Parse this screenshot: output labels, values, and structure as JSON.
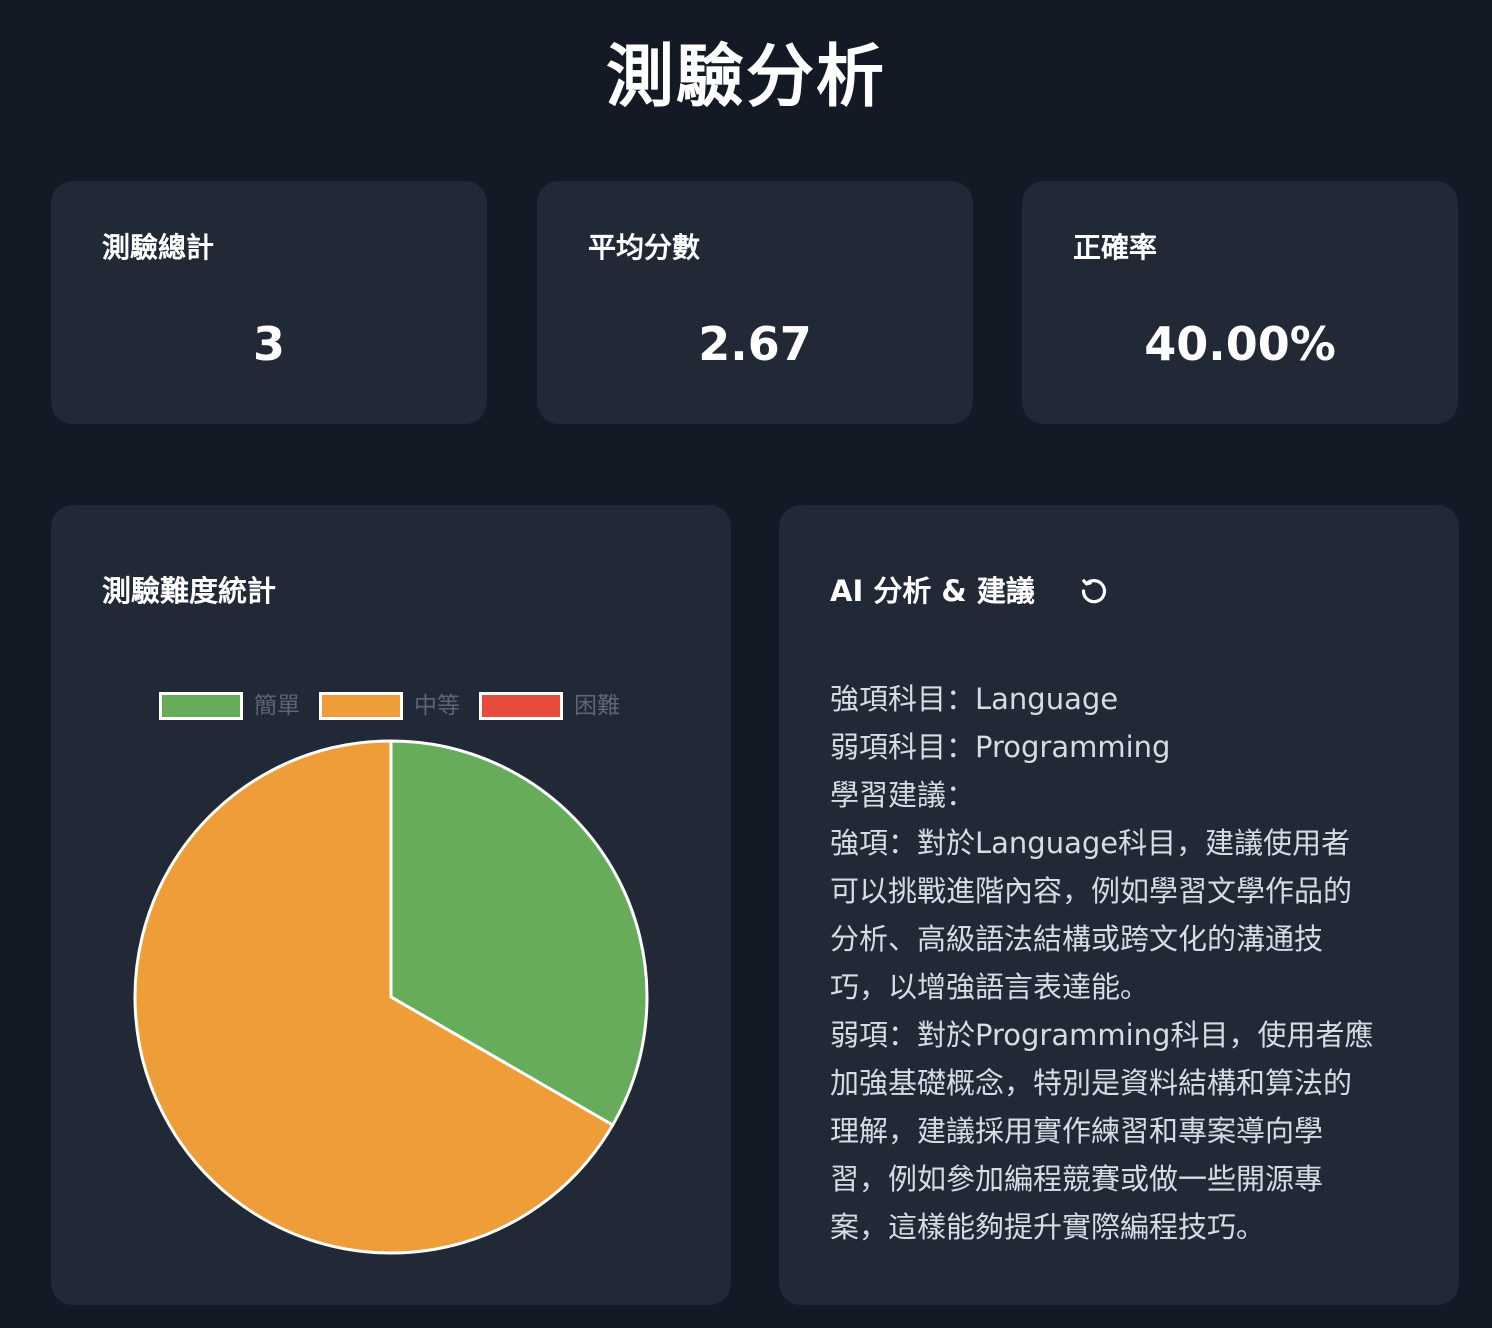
{
  "header": {
    "title": "測驗分析"
  },
  "stats": [
    {
      "label": "測驗總計",
      "value": "3"
    },
    {
      "label": "平均分數",
      "value": "2.67"
    },
    {
      "label": "正確率",
      "value": "40.00%"
    }
  ],
  "difficulty_panel": {
    "title": "測驗難度統計"
  },
  "chart_data": {
    "type": "pie",
    "categories": [
      "簡單",
      "中等",
      "困難"
    ],
    "values": [
      1,
      2,
      0
    ],
    "colors": [
      "#67ac5b",
      "#ef9d38",
      "#e74c3c"
    ],
    "legend_position": "top"
  },
  "ai_panel": {
    "title": "AI 分析 & 建議",
    "refresh_icon": "refresh-icon",
    "lines": [
      "強項科目：Language",
      "弱項科目：Programming",
      "學習建議：",
      "強項：對於Language科目，建議使用者",
      "可以挑戰進階內容，例如學習文學作品的",
      "分析、高級語法結構或跨文化的溝通技",
      "巧，以增強語言表達能。",
      "弱項：對於Programming科目，使用者應",
      "加強基礎概念，特別是資料結構和算法的",
      "理解，建議採用實作練習和專案導向學",
      "習，例如參加編程競賽或做一些開源專",
      "案，這樣能夠提升實際編程技巧。"
    ]
  }
}
